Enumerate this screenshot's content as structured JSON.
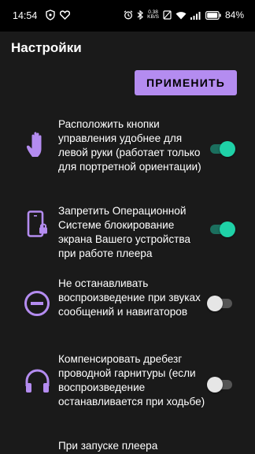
{
  "status_bar": {
    "time": "14:54",
    "speed_value": "0.38",
    "speed_unit": "KB/S",
    "battery": "84%"
  },
  "header": {
    "title": "Настройки"
  },
  "apply_button": {
    "label": "ПРИМЕНИТЬ"
  },
  "settings": [
    {
      "text": "Расположить кнопки управления удобнее для левой руки (работает только для портретной ориентации)",
      "icon": "hand-icon",
      "enabled": true
    },
    {
      "text": "Запретить Операционной Системе блокирование экрана Вашего устройства при работе плеера",
      "icon": "phone-lock-icon",
      "enabled": true
    },
    {
      "text": "Не останавливать воспроизведение при звуках сообщений и навигаторов",
      "icon": "no-entry-icon",
      "enabled": false
    },
    {
      "text": "Компенсировать дребезг проводной гарнитуры (если воспроизведение останавливается при ходьбе)",
      "icon": "headphones-icon",
      "enabled": false
    },
    {
      "text": "При запуске плеера",
      "icon": "",
      "enabled": null
    }
  ],
  "colors": {
    "accent": "#b48cf0",
    "toggle_on": "#1fd1a7",
    "background": "#1a1a1a"
  }
}
